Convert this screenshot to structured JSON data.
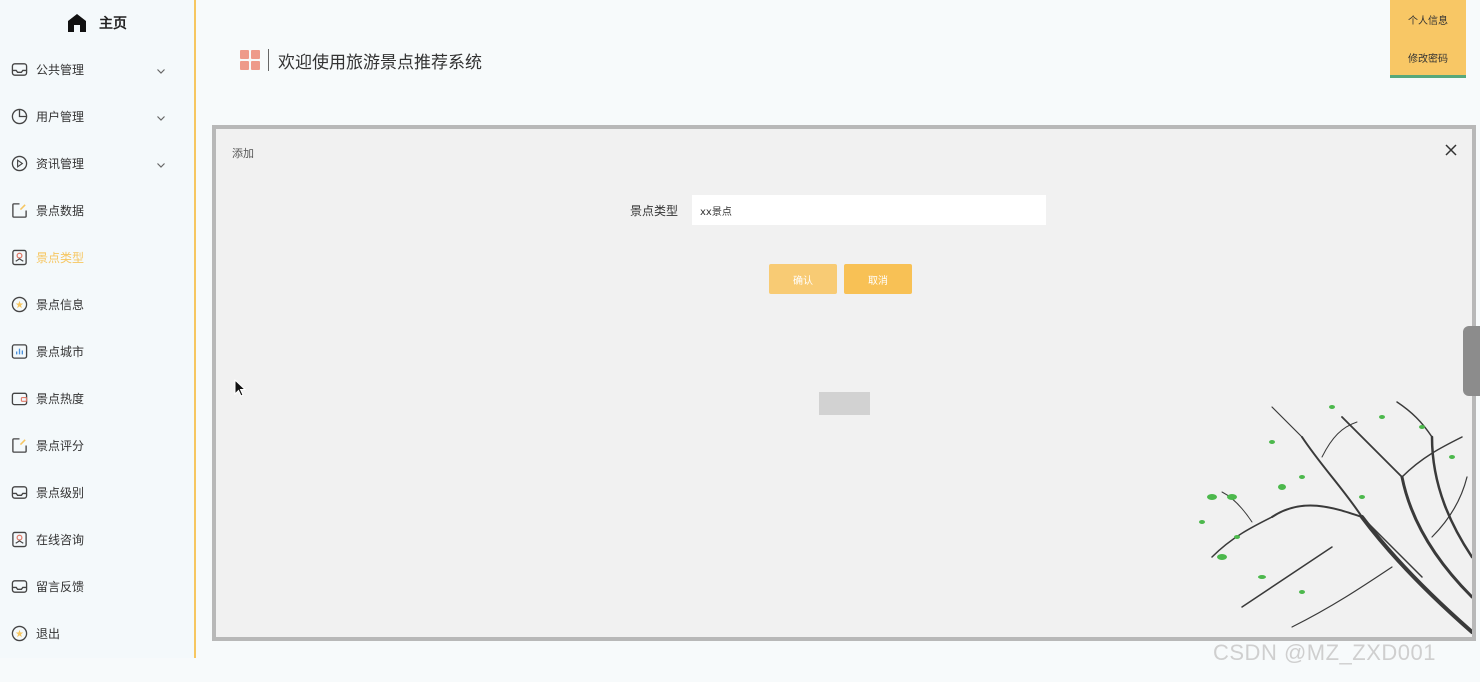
{
  "sidebar": {
    "home_label": "主页",
    "items": [
      {
        "label": "公共管理",
        "icon": "inbox-icon",
        "expandable": true
      },
      {
        "label": "用户管理",
        "icon": "pie-chart-icon",
        "expandable": true
      },
      {
        "label": "资讯管理",
        "icon": "play-circle-icon",
        "expandable": true
      },
      {
        "label": "景点数据",
        "icon": "edit-icon",
        "expandable": false
      },
      {
        "label": "景点类型",
        "icon": "badge-icon",
        "expandable": false,
        "active": true
      },
      {
        "label": "景点信息",
        "icon": "star-circle-icon",
        "expandable": false
      },
      {
        "label": "景点城市",
        "icon": "bar-chart-icon",
        "expandable": false
      },
      {
        "label": "景点热度",
        "icon": "wallet-icon",
        "expandable": false
      },
      {
        "label": "景点评分",
        "icon": "edit-icon",
        "expandable": false
      },
      {
        "label": "景点级别",
        "icon": "inbox-icon",
        "expandable": false
      },
      {
        "label": "在线咨询",
        "icon": "badge-icon",
        "expandable": false
      },
      {
        "label": "留言反馈",
        "icon": "inbox-icon",
        "expandable": false
      },
      {
        "label": "退出",
        "icon": "star-circle-icon",
        "expandable": false
      }
    ]
  },
  "header": {
    "title": "欢迎使用旅游景点推荐系统"
  },
  "user_menu": {
    "profile_label": "个人信息",
    "password_label": "修改密码"
  },
  "dialog": {
    "title": "添加",
    "field_label": "景点类型",
    "field_value": "xx景点",
    "confirm_label": "确认",
    "cancel_label": "取消"
  },
  "watermark": "CSDN @MZ_ZXD001",
  "colors": {
    "accent": "#f6c660",
    "menu_underline": "#57a87b",
    "grid_icon": "#ee9a8a"
  }
}
